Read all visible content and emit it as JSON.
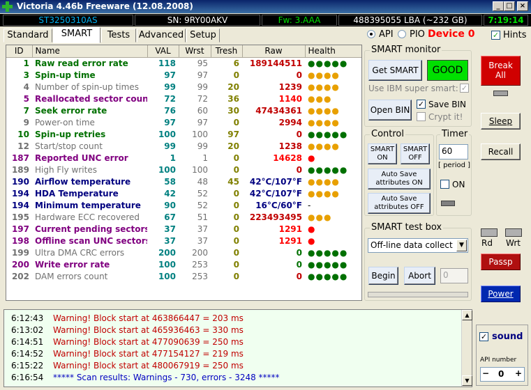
{
  "window": {
    "title": "Victoria 4.46b Freeware (12.08.2008)"
  },
  "infobar": {
    "model": "ST3250310AS",
    "serial": "SN: 9RY00AKV",
    "firmware": "Fw: 3.AAA",
    "lba": "488395055 LBA (~232 GB)",
    "time": "7:19:14"
  },
  "tabs": [
    "Standard",
    "SMART",
    "Tests",
    "Advanced",
    "Setup"
  ],
  "mode": {
    "api": "API",
    "pio": "PIO",
    "device": "Device 0",
    "hints": "Hints"
  },
  "smart_table": {
    "headers": [
      "ID",
      "Name",
      "VAL",
      "Wrst",
      "Tresh",
      "Raw",
      "Health"
    ],
    "rows": [
      {
        "id": "1",
        "name": "Raw read error rate",
        "val": "118",
        "wrst": "95",
        "tresh": "6",
        "raw": "189144511",
        "health": "●●●●●",
        "color": "#007000",
        "rawcolor": "#c00000",
        "hcolor": "#007000"
      },
      {
        "id": "3",
        "name": "Spin-up time",
        "val": "97",
        "wrst": "97",
        "tresh": "0",
        "raw": "0",
        "health": "●●●●",
        "color": "#007000",
        "rawcolor": "#c00000",
        "hcolor": "#e8a000"
      },
      {
        "id": "4",
        "name": "Number of spin-up times",
        "val": "99",
        "wrst": "99",
        "tresh": "20",
        "raw": "1239",
        "health": "●●●●",
        "color": "#707070",
        "rawcolor": "#c00000",
        "hcolor": "#e8a000"
      },
      {
        "id": "5",
        "name": "Reallocated sector count",
        "val": "72",
        "wrst": "72",
        "tresh": "36",
        "raw": "1140",
        "health": "●●●",
        "color": "#800080",
        "rawcolor": "#ff0000",
        "hcolor": "#e8a000"
      },
      {
        "id": "7",
        "name": "Seek error rate",
        "val": "76",
        "wrst": "60",
        "tresh": "30",
        "raw": "47434361",
        "health": "●●●●",
        "color": "#007000",
        "rawcolor": "#c00000",
        "hcolor": "#e8a000"
      },
      {
        "id": "9",
        "name": "Power-on time",
        "val": "97",
        "wrst": "97",
        "tresh": "0",
        "raw": "2994",
        "health": "●●●●",
        "color": "#707070",
        "rawcolor": "#c00000",
        "hcolor": "#e8a000"
      },
      {
        "id": "10",
        "name": "Spin-up retries",
        "val": "100",
        "wrst": "100",
        "tresh": "97",
        "raw": "0",
        "health": "●●●●●",
        "color": "#007000",
        "rawcolor": "#c00000",
        "hcolor": "#007000"
      },
      {
        "id": "12",
        "name": "Start/stop count",
        "val": "99",
        "wrst": "99",
        "tresh": "20",
        "raw": "1238",
        "health": "●●●●",
        "color": "#707070",
        "rawcolor": "#c00000",
        "hcolor": "#e8a000"
      },
      {
        "id": "187",
        "name": "Reported UNC error",
        "val": "1",
        "wrst": "1",
        "tresh": "0",
        "raw": "14628",
        "health": "●",
        "color": "#800080",
        "rawcolor": "#ff0000",
        "hcolor": "#ff0000"
      },
      {
        "id": "189",
        "name": "High Fly writes",
        "val": "100",
        "wrst": "100",
        "tresh": "0",
        "raw": "0",
        "health": "●●●●●",
        "color": "#707070",
        "rawcolor": "#c00000",
        "hcolor": "#007000"
      },
      {
        "id": "190",
        "name": "Airflow temperature",
        "val": "58",
        "wrst": "48",
        "tresh": "45",
        "raw": "42°C/107°F",
        "health": "●●●●",
        "color": "#000080",
        "rawcolor": "#000080",
        "hcolor": "#e8a000"
      },
      {
        "id": "194",
        "name": "HDA Temperature",
        "val": "42",
        "wrst": "52",
        "tresh": "0",
        "raw": "42°C/107°F",
        "health": "●●●●",
        "color": "#000080",
        "rawcolor": "#000080",
        "hcolor": "#e8a000"
      },
      {
        "id": "194",
        "name": "Minimum temperature",
        "val": "90",
        "wrst": "52",
        "tresh": "0",
        "raw": "16°C/60°F",
        "health": "-",
        "color": "#000080",
        "rawcolor": "#000080",
        "hcolor": "#000000"
      },
      {
        "id": "195",
        "name": "Hardware ECC recovered",
        "val": "67",
        "wrst": "51",
        "tresh": "0",
        "raw": "223493495",
        "health": "●●●",
        "color": "#707070",
        "rawcolor": "#c00000",
        "hcolor": "#e8a000"
      },
      {
        "id": "197",
        "name": "Current pending sectors",
        "val": "37",
        "wrst": "37",
        "tresh": "0",
        "raw": "1291",
        "health": "●",
        "color": "#800080",
        "rawcolor": "#ff0000",
        "hcolor": "#ff0000"
      },
      {
        "id": "198",
        "name": "Offline scan UNC sectors",
        "val": "37",
        "wrst": "37",
        "tresh": "0",
        "raw": "1291",
        "health": "●",
        "color": "#800080",
        "rawcolor": "#ff0000",
        "hcolor": "#ff0000"
      },
      {
        "id": "199",
        "name": "Ultra DMA CRC errors",
        "val": "200",
        "wrst": "200",
        "tresh": "0",
        "raw": "0",
        "health": "●●●●●",
        "color": "#707070",
        "rawcolor": "#007000",
        "hcolor": "#007000"
      },
      {
        "id": "200",
        "name": "Write error rate",
        "val": "100",
        "wrst": "253",
        "tresh": "0",
        "raw": "0",
        "health": "●●●●●",
        "color": "#800080",
        "rawcolor": "#007000",
        "hcolor": "#007000"
      },
      {
        "id": "202",
        "name": "DAM errors count",
        "val": "100",
        "wrst": "253",
        "tresh": "0",
        "raw": "0",
        "health": "●●●●●",
        "color": "#707070",
        "rawcolor": "#c00000",
        "hcolor": "#007000"
      }
    ]
  },
  "smart_monitor": {
    "label": "SMART monitor",
    "get_smart": "Get SMART",
    "status": "GOOD",
    "ibm_label": "Use IBM super smart:",
    "open_bin": "Open BIN",
    "save_bin": "Save BIN",
    "crypt": "Crypt it!"
  },
  "control": {
    "label": "Control",
    "smart_on": [
      "SMART",
      "ON"
    ],
    "smart_off": [
      "SMART",
      "OFF"
    ],
    "autosave_on": [
      "Auto Save",
      "attributes ON"
    ],
    "autosave_off": [
      "Auto Save",
      "attributes OFF"
    ]
  },
  "timer": {
    "label": "Timer",
    "value": "60",
    "period": "[ period ]",
    "on": "ON"
  },
  "test_box": {
    "label": "SMART test box",
    "selected": "Off-line data collect",
    "begin": "Begin",
    "abort": "Abort",
    "value": "0"
  },
  "right_panel": {
    "break_all": [
      "Break",
      "All"
    ],
    "sleep": "Sleep",
    "recall": "Recall",
    "rd": "Rd",
    "wrt": "Wrt",
    "passp": "Passp",
    "power": "Power",
    "sound": "sound",
    "api_number": "API number",
    "api_value": "0",
    "minus": "−",
    "plus": "+"
  },
  "log": [
    {
      "time": "6:12:43",
      "msg": "Warning! Block start at 463866447 = 203 ms",
      "color": "#c00000"
    },
    {
      "time": "6:13:02",
      "msg": "Warning! Block start at 465936463 = 330 ms",
      "color": "#c00000"
    },
    {
      "time": "6:14:51",
      "msg": "Warning! Block start at 477090639 = 250 ms",
      "color": "#c00000"
    },
    {
      "time": "6:14:52",
      "msg": "Warning! Block start at 477154127 = 219 ms",
      "color": "#c00000"
    },
    {
      "time": "6:15:22",
      "msg": "Warning! Block start at 480067919 = 250 ms",
      "color": "#c00000"
    },
    {
      "time": "6:16:54",
      "msg": "***** Scan results: Warnings - 730, errors - 3248 *****",
      "color": "#0000c0"
    }
  ]
}
